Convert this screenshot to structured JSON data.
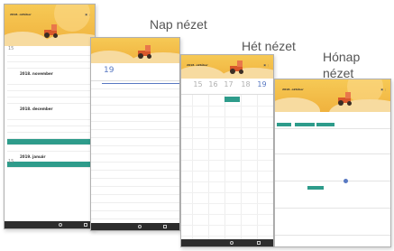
{
  "captions": {
    "day_view": "Nap nézet",
    "week_view": "Hét nézet",
    "month_view_line1": "Hónap",
    "month_view_line2": "nézet"
  },
  "agenda_screen": {
    "month_label": "2018. október",
    "headings": [
      "2018. november",
      "2018. december",
      "2019. január"
    ],
    "visible_numbers": [
      "15",
      "15"
    ]
  },
  "day_screen": {
    "day_number": "19"
  },
  "week_screen": {
    "month_label": "2018. október",
    "days": [
      "15",
      "16",
      "17",
      "18",
      "19"
    ]
  },
  "month_screen": {
    "month_label": "2018. október"
  },
  "colors": {
    "banner": "#f0b23e",
    "accent_teal": "#2e9c8b",
    "accent_blue": "#5879c2"
  }
}
